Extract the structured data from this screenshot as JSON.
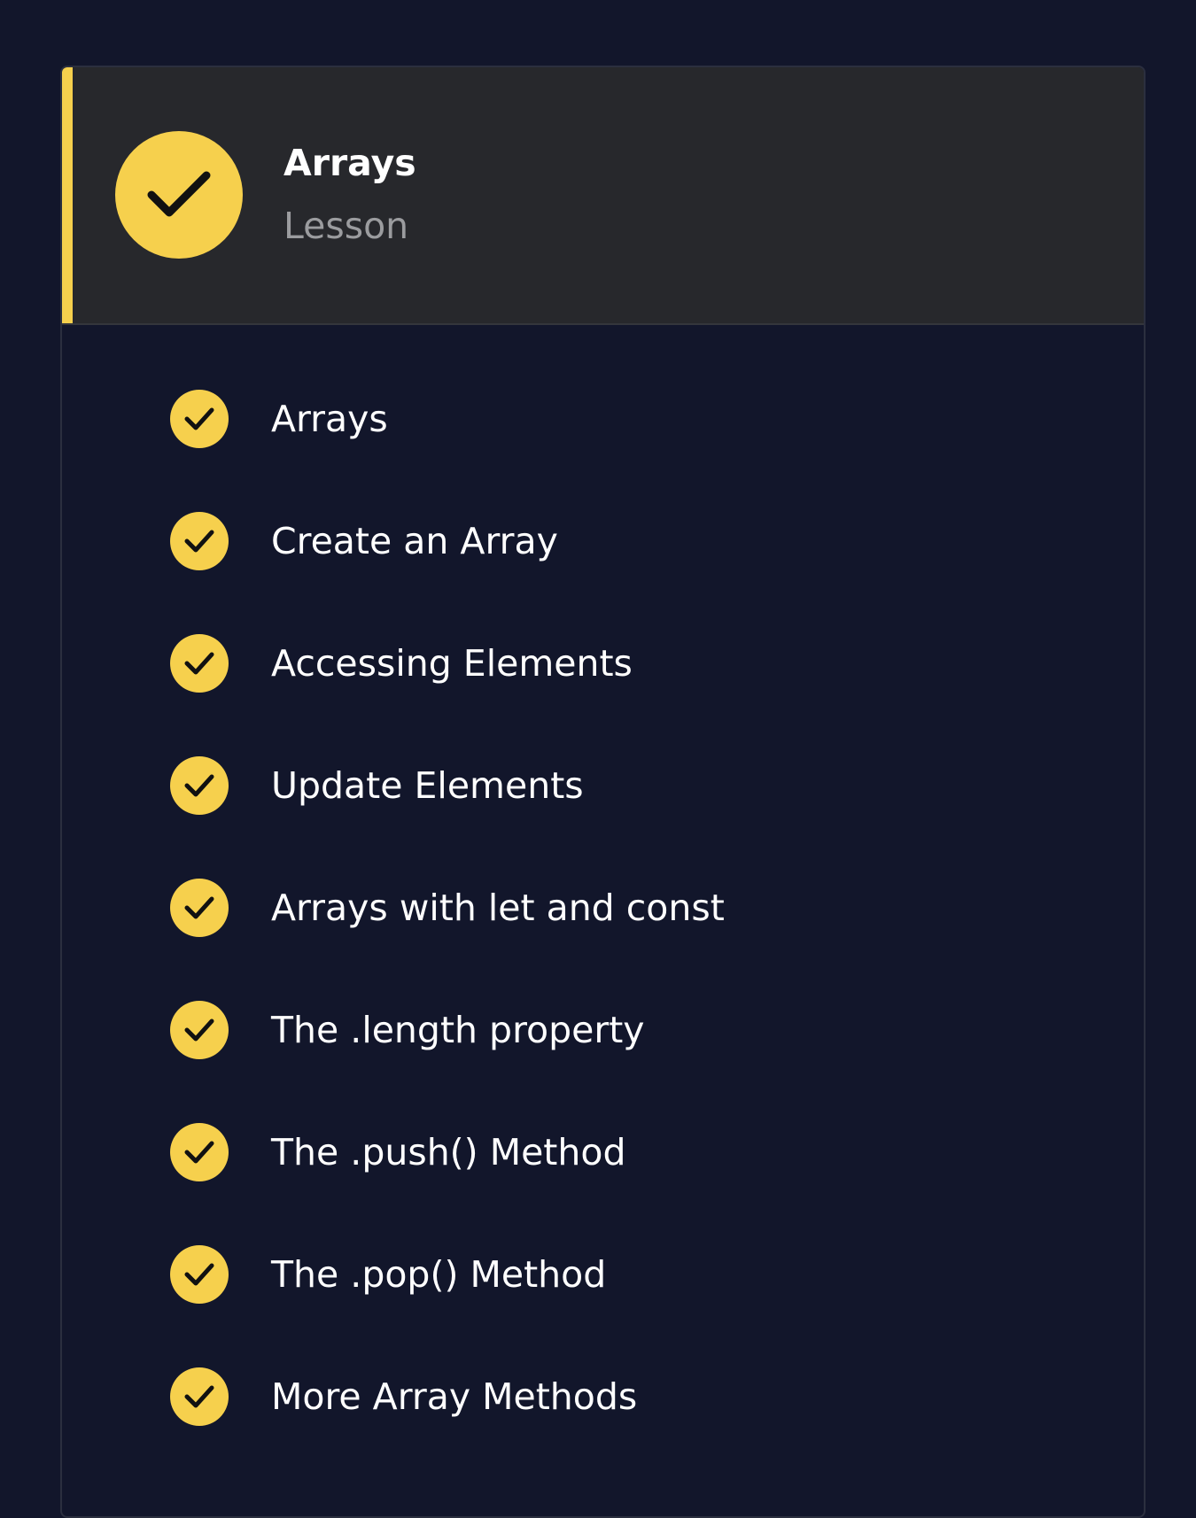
{
  "lesson": {
    "title": "Arrays",
    "type_label": "Lesson",
    "status_icon": "check-circle-icon",
    "accent_color": "#f6d04d"
  },
  "items": [
    {
      "label": "Arrays",
      "status": "completed",
      "icon": "check-circle-icon"
    },
    {
      "label": "Create an Array",
      "status": "completed",
      "icon": "check-circle-icon"
    },
    {
      "label": "Accessing Elements",
      "status": "completed",
      "icon": "check-circle-icon"
    },
    {
      "label": "Update Elements",
      "status": "completed",
      "icon": "check-circle-icon"
    },
    {
      "label": "Arrays with let and const",
      "status": "completed",
      "icon": "check-circle-icon"
    },
    {
      "label": "The .length property",
      "status": "completed",
      "icon": "check-circle-icon"
    },
    {
      "label": "The .push() Method",
      "status": "completed",
      "icon": "check-circle-icon"
    },
    {
      "label": "The .pop() Method",
      "status": "completed",
      "icon": "check-circle-icon"
    },
    {
      "label": "More Array Methods",
      "status": "completed",
      "icon": "check-circle-icon"
    }
  ],
  "colors": {
    "background": "#12162b",
    "header_background": "#27282c",
    "accent": "#f6d04d",
    "text": "#ffffff",
    "muted_text": "#9b9c9f"
  }
}
